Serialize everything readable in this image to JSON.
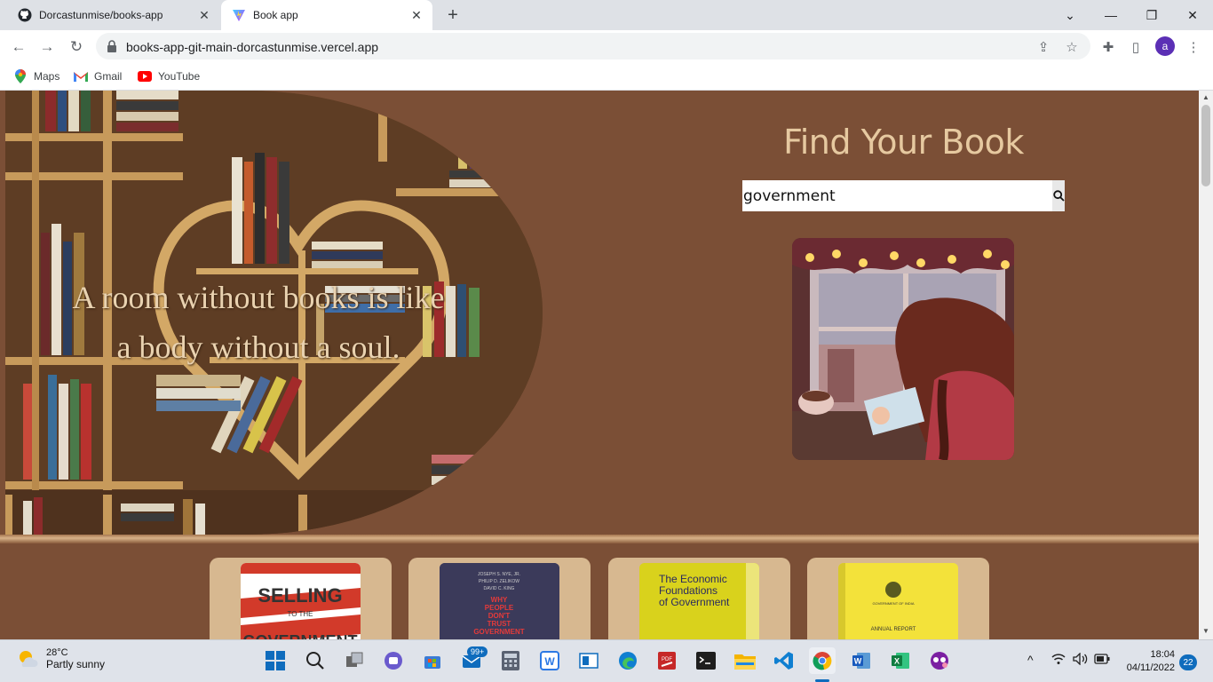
{
  "browser": {
    "tabs": [
      {
        "title": "Dorcastunmise/books-app",
        "active": false,
        "icon": "github-icon"
      },
      {
        "title": "Book app",
        "active": true,
        "icon": "vercel-icon"
      }
    ],
    "url": "books-app-git-main-dorcastunmise.vercel.app",
    "profile_initial": "a",
    "bookmarks": [
      {
        "label": "Maps",
        "icon": "maps-icon"
      },
      {
        "label": "Gmail",
        "icon": "gmail-icon"
      },
      {
        "label": "YouTube",
        "icon": "youtube-icon"
      }
    ]
  },
  "hero": {
    "quote_line1": "A room without books is like",
    "quote_line2": "a body without a soul."
  },
  "search_panel": {
    "title": "Find Your Book",
    "query": "government"
  },
  "results": [
    {
      "cover_title": "SELLING TO THE GOVERNMENT",
      "cover_color": "#ffffff"
    },
    {
      "cover_title": "WHY PEOPLE DON'T TRUST GOVERNMENT",
      "cover_color": "#3b3a5a"
    },
    {
      "cover_title": "The Economic Foundations of Government",
      "cover_color": "#d9d21c"
    },
    {
      "cover_title": "ANNUAL REPORT",
      "cover_color": "#f0e13a"
    }
  ],
  "taskbar": {
    "temperature": "28°C",
    "condition": "Partly sunny",
    "mail_badge": "99+",
    "time": "18:04",
    "date": "04/11/2022",
    "notifications": "22"
  }
}
